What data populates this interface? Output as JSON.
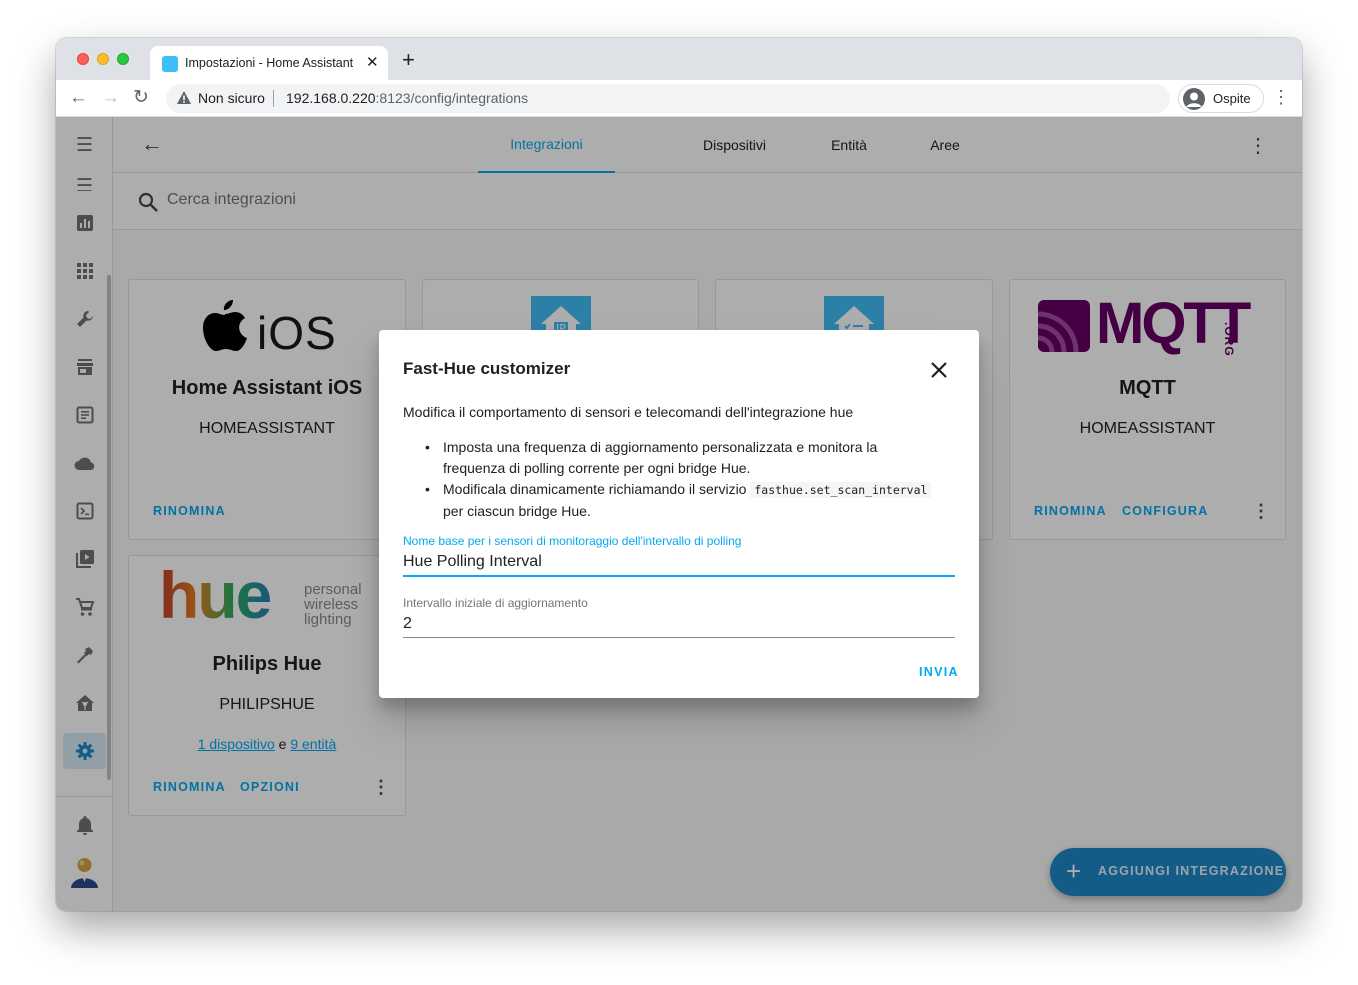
{
  "browser": {
    "tab_title": "Impostazioni - Home Assistant",
    "tab_close": "✕",
    "new_tab": "+",
    "security_label": "Non sicuro",
    "url_host": "192.168.0.220",
    "url_path": ":8123/config/integrations",
    "profile_label": "Ospite"
  },
  "header": {
    "back": "←",
    "tabs": [
      {
        "label": "Integrazioni"
      },
      {
        "label": "Dispositivi"
      },
      {
        "label": "Entità"
      },
      {
        "label": "Aree"
      }
    ],
    "active_tab": "Integrazioni",
    "menu": "⋮"
  },
  "search": {
    "placeholder": "Cerca integrazioni"
  },
  "cards": [
    {
      "logo_text": "iOS",
      "title": "Home Assistant iOS",
      "domain": "HOMEASSISTANT",
      "actions": [
        "RINOMINA"
      ]
    },
    {
      "logo": "home-assistant-ip-icon"
    },
    {
      "logo": "home-assistant-checklist-icon"
    },
    {
      "logo_text": "MQTT",
      "logo_suffix": ".ORG",
      "title": "MQTT",
      "domain": "HOMEASSISTANT",
      "actions": [
        "RINOMINA",
        "CONFIGURA"
      ]
    },
    {
      "logo_text": "hue",
      "logo_tagline": [
        "personal",
        "wireless",
        "lighting"
      ],
      "title": "Philips Hue",
      "domain": "PHILIPSHUE",
      "links": {
        "devices": "1 dispositivo",
        "joiner": "e",
        "entities": "9 entità"
      },
      "actions": [
        "RINOMINA",
        "OPZIONI"
      ]
    }
  ],
  "fab": {
    "icon": "+",
    "label": "AGGIUNGI INTEGRAZIONE"
  },
  "dialog": {
    "title": "Fast-Hue customizer",
    "description": "Modifica il comportamento di sensori e telecomandi dell'integrazione hue",
    "bullets": {
      "first": "Imposta una frequenza di aggiornamento personalizzata e monitora la frequenza di polling corrente per ogni bridge Hue.",
      "second_before": "Modificala dinamicamente richiamando il servizio",
      "second_code": "fasthue.set_scan_interval",
      "second_after": "per ciascun bridge Hue."
    },
    "fields": [
      {
        "label": "Nome base per i sensori di monitoraggio dell'intervallo di polling",
        "value": "Hue Polling Interval"
      },
      {
        "label": "Intervallo iniziale di aggiornamento",
        "value": "2"
      }
    ],
    "submit_label": "INVIA"
  },
  "colors": {
    "accent": "#03a9f4",
    "fab": "#1e88c9",
    "ha_blue": "#41bdf5"
  }
}
